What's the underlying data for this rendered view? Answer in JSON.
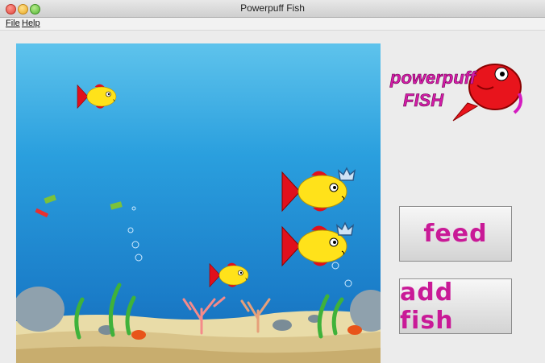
{
  "window": {
    "title": "Powerpuff Fish"
  },
  "menu": {
    "file": "File",
    "help": "Help"
  },
  "logo": {
    "line1": "powerpuff",
    "line2": "FISH"
  },
  "buttons": {
    "feed": "feed",
    "add_fish": "add fish"
  },
  "colors": {
    "fish_body": "#ffe21a",
    "fish_fins": "#e0101c",
    "brand_pink": "#c91a97",
    "water_top": "#5ec3ec",
    "water_bottom": "#1669b5"
  }
}
